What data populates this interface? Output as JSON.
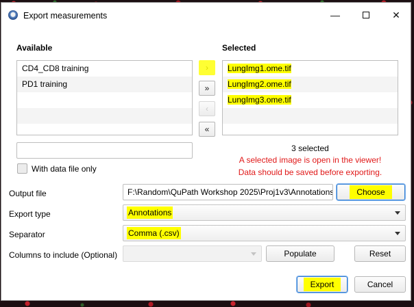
{
  "window": {
    "title": "Export measurements",
    "minimize_glyph": "—",
    "close_glyph": "✕"
  },
  "available": {
    "heading": "Available",
    "items": [
      "CD4_CD8 training",
      "PD1 training"
    ],
    "filter_value": "",
    "checkbox_label": "With data file only"
  },
  "selected": {
    "heading": "Selected",
    "items": [
      "LungImg1.ome.tif",
      "LungImg2.ome.tif",
      "LungImg3.ome.tif"
    ],
    "count_text": "3 selected",
    "warning_line1": "A selected image is open in the viewer!",
    "warning_line2": "Data should be saved before exporting."
  },
  "move_buttons": {
    "add_one": "›",
    "add_all": "»",
    "remove_one": "‹",
    "remove_all": "«"
  },
  "form": {
    "output_label": "Output file",
    "output_value": "F:\\Random\\QuPath Workshop 2025\\Proj1v3\\Annotations",
    "choose_label": "Choose",
    "export_type_label": "Export type",
    "export_type_value": "Annotations",
    "separator_label": "Separator",
    "separator_value": "Comma (.csv)",
    "columns_label": "Columns to include (Optional)",
    "columns_value": "",
    "populate_label": "Populate",
    "reset_label": "Reset"
  },
  "footer": {
    "export_label": "Export",
    "cancel_label": "Cancel"
  },
  "colors": {
    "highlight": "#ffff00",
    "warning": "#e01818",
    "focus": "#2d7bd3"
  }
}
